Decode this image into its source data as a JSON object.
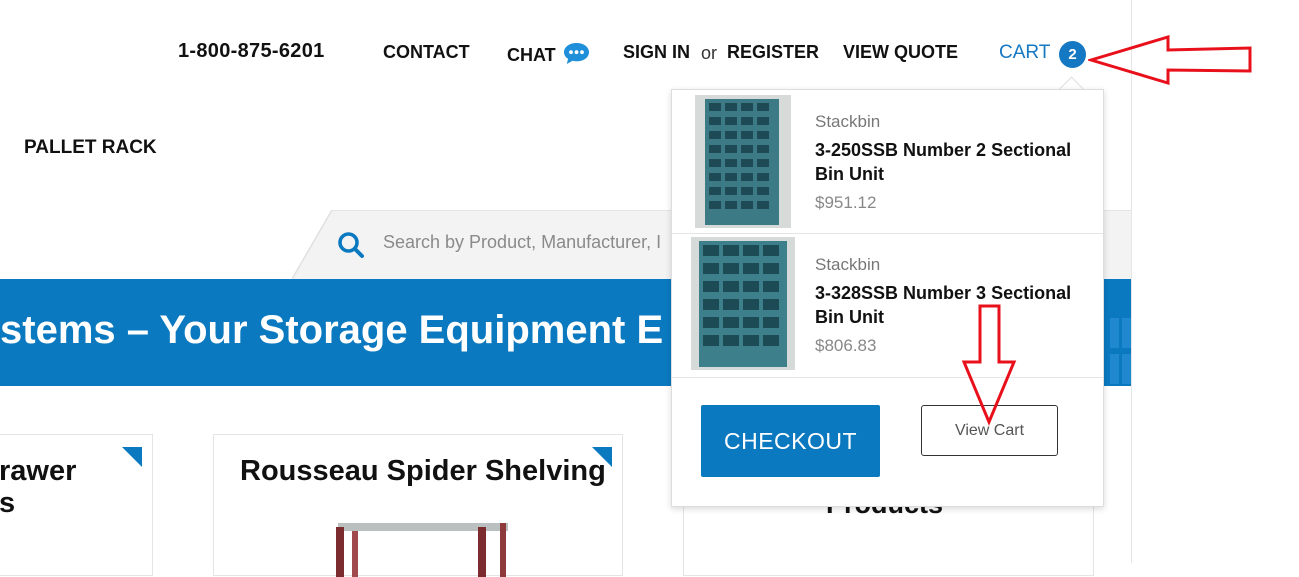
{
  "topnav": {
    "phone": "1-800-875-6201",
    "contact": "CONTACT",
    "chat": "CHAT",
    "sign_in": "SIGN IN",
    "or": "or",
    "register": "REGISTER",
    "view_quote": "VIEW QUOTE",
    "cart": "CART",
    "cart_count": "2"
  },
  "menu": {
    "pallet_rack": "PALLET RACK"
  },
  "search": {
    "placeholder": "Search by Product, Manufacturer, I"
  },
  "banner": {
    "text": "stems – Your Storage Equipment E"
  },
  "cards": [
    {
      "title_line1": "rawer",
      "title_line2": "s"
    },
    {
      "title": "Rousseau Spider Shelving"
    },
    {
      "title": "Products"
    }
  ],
  "cart_dropdown": {
    "items": [
      {
        "brand": "Stackbin",
        "name": "3-250SSB Number 2 Sectional Bin Unit",
        "price": "$951.12",
        "icon": "bin-unit-image"
      },
      {
        "brand": "Stackbin",
        "name": "3-328SSB Number 3 Sectional Bin Unit",
        "price": "$806.83",
        "icon": "bin-unit-image"
      }
    ],
    "checkout_label": "CHECKOUT",
    "view_cart_label": "View Cart"
  },
  "colors": {
    "brand_blue": "#0b79c0",
    "cart_blue": "#1578c2",
    "annotation_red": "#e8101a"
  }
}
